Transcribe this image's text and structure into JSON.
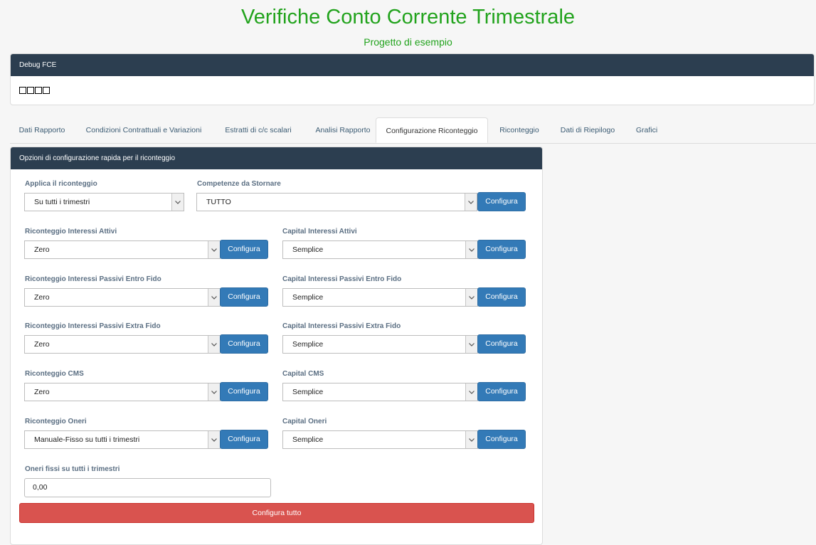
{
  "header": {
    "title": "Verifiche Conto Corrente Trimestrale",
    "subtitle": "Progetto di esempio"
  },
  "debug": {
    "title": "Debug FCE"
  },
  "tabs": [
    {
      "label": "Dati Rapporto"
    },
    {
      "label": "Condizioni Contrattuali e Variazioni"
    },
    {
      "label": "Estratti di c/c scalari"
    },
    {
      "label": "Analisi Rapporto"
    },
    {
      "label": "Configurazione Riconteggio",
      "active": true
    },
    {
      "label": "Riconteggio"
    },
    {
      "label": "Dati di Riepilogo"
    },
    {
      "label": "Grafici"
    }
  ],
  "config": {
    "title": "Opzioni di configurazione rapida per il riconteggio",
    "configure_label": "Configura",
    "applica": {
      "label": "Applica il riconteggio",
      "value": "Su tutti i trimestri"
    },
    "competenze": {
      "label": "Competenze da Stornare",
      "value": "TUTTO"
    },
    "rows": [
      {
        "left": {
          "label": "Riconteggio Interessi Attivi",
          "value": "Zero"
        },
        "right": {
          "label": "Capital Interessi Attivi",
          "value": "Semplice"
        }
      },
      {
        "left": {
          "label": "Riconteggio Interessi Passivi Entro Fido",
          "value": "Zero"
        },
        "right": {
          "label": "Capital Interessi Passivi Entro Fido",
          "value": "Semplice"
        }
      },
      {
        "left": {
          "label": "Riconteggio Interessi Passivi Extra Fido",
          "value": "Zero"
        },
        "right": {
          "label": "Capital Interessi Passivi Extra Fido",
          "value": "Semplice"
        }
      },
      {
        "left": {
          "label": "Riconteggio CMS",
          "value": "Zero"
        },
        "right": {
          "label": "Capital CMS",
          "value": "Semplice"
        }
      },
      {
        "left": {
          "label": "Riconteggio Oneri",
          "value": "Manuale-Fisso su tutti i trimestri"
        },
        "right": {
          "label": "Capital Oneri",
          "value": "Semplice"
        }
      }
    ],
    "oneri_fissi": {
      "label": "Oneri fissi su tutti i trimestri",
      "value": "0,00"
    },
    "configure_all_label": "Configura tutto"
  },
  "colors": {
    "title_green": "#22a31d",
    "panel_header": "#2c3e50",
    "primary_button": "#337ab7",
    "danger_button": "#d9534f"
  }
}
